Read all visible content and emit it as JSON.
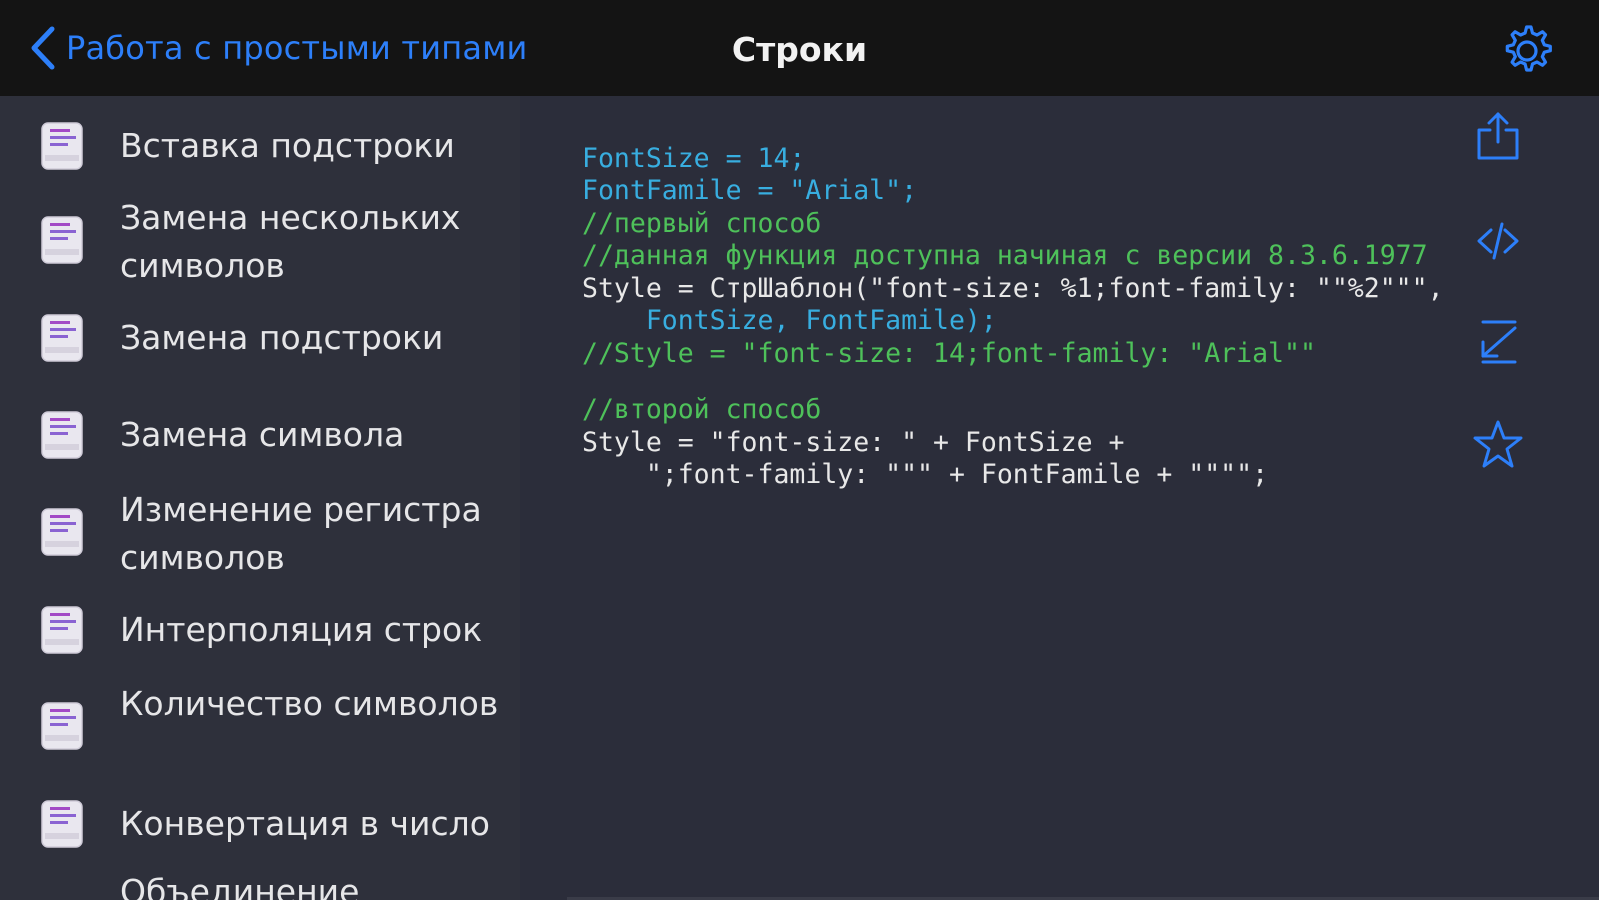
{
  "navbar": {
    "back_label": "Работа с простыми типами",
    "title": "Строки",
    "accent_color": "#2d7ff9",
    "settings_icon": "gear-icon"
  },
  "sidebar": {
    "items": [
      {
        "label": "Вставка подстроки",
        "icon": "code-document-icon"
      },
      {
        "label": "Замена нескольких символов",
        "icon": "code-document-icon"
      },
      {
        "label": "Замена подстроки",
        "icon": "code-document-icon"
      },
      {
        "label": "Замена символа",
        "icon": "code-document-icon"
      },
      {
        "label": "Изменение регистра символов",
        "icon": "code-document-icon"
      },
      {
        "label": "Интерполяция строк",
        "icon": "code-document-icon"
      },
      {
        "label": "Количество символов",
        "icon": "code-document-icon"
      },
      {
        "label": "Конвертация в число",
        "icon": "code-document-icon"
      },
      {
        "label": "Объединение",
        "icon": "code-document-icon"
      }
    ]
  },
  "code": {
    "lines": [
      "FontSize = 14;",
      "FontFamile = \"Arial\";",
      "//первый способ",
      "//данная функция доступна начиная с версии 8.3.6.1977",
      "Style = СтрШаблон(\"font-size: %1;font-family: \"\"%2\"\"\",",
      "    FontSize, FontFamile);",
      "//Style = \"font-size: 14;font-family: \"Arial\"\"",
      "",
      "//второй способ",
      "Style = \"font-size: \" + FontSize +",
      "    \";font-family: \"\"\" + FontFamile + \"\"\"\";"
    ]
  },
  "actions": [
    {
      "icon": "share-icon"
    },
    {
      "icon": "code-icon"
    },
    {
      "icon": "collapse-icon"
    },
    {
      "icon": "star-icon"
    }
  ]
}
